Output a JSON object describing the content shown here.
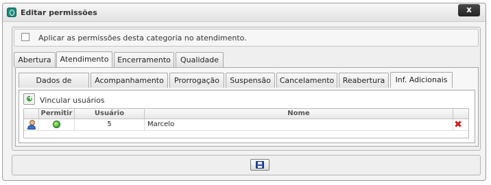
{
  "window": {
    "title": "Editar permissões",
    "close_label": "x"
  },
  "category": {
    "apply_label": "Aplicar as permissões desta categoria no atendimento.",
    "checked": false
  },
  "tabs": [
    {
      "label": "Abertura",
      "active": false
    },
    {
      "label": "Atendimento",
      "active": true
    },
    {
      "label": "Encerramento",
      "active": false
    },
    {
      "label": "Qualidade",
      "active": false
    }
  ],
  "subtabs": [
    {
      "label": "Dados de abertura",
      "active": false
    },
    {
      "label": "Acompanhamento",
      "active": false
    },
    {
      "label": "Prorrogação",
      "active": false
    },
    {
      "label": "Suspensão",
      "active": false
    },
    {
      "label": "Cancelamento",
      "active": false
    },
    {
      "label": "Reabertura",
      "active": false
    },
    {
      "label": "Inf. Adicionais",
      "active": true
    }
  ],
  "link_users_label": "Vincular usuários",
  "grid": {
    "columns": [
      "Permitir",
      "Usuário",
      "Nome"
    ],
    "rows": [
      {
        "permitir": "green-status-icon",
        "usuario": "5",
        "nome": "Marcelo"
      }
    ]
  },
  "icons": {
    "add": "add-user-icon",
    "save": "floppy-disk-icon",
    "delete": "delete-x-icon",
    "user": "user-icon"
  }
}
